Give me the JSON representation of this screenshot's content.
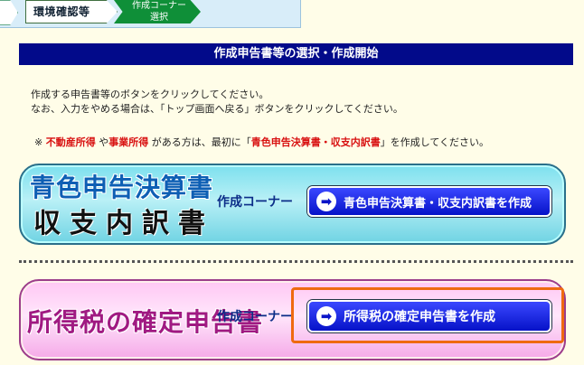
{
  "steps": {
    "confirm": "環境確認等",
    "current_l1": "作成コーナー",
    "current_l2": "選択"
  },
  "header": {
    "title": "作成申告書等の選択・作成開始"
  },
  "instructions": {
    "line1": "作成する申告書等のボタンをクリックしてください。",
    "line2": "なお、入力をやめる場合は、「トップ画面へ戻る」ボタンをクリックしてください。"
  },
  "note": {
    "prefix": "※ ",
    "real_estate": "不動産所得",
    "ya": " や",
    "business": "事業所得",
    "mid": " がある方は、最初に「",
    "docs": "青色申告決算書・収支内訳書",
    "suffix": "」を作成してください。"
  },
  "blue_corner": {
    "title_line1": "青色申告決算書",
    "title_line2": "収支内訳書",
    "corner_label": "作成コーナー",
    "button_label": "青色申告決算書・収支内訳書を作成"
  },
  "income_tax_corner": {
    "title": "所得税の確定申告書",
    "corner_label": "作成コーナー",
    "button_label": "所得税の確定申告書を作成"
  },
  "icons": {
    "arrow": "➡"
  },
  "colors": {
    "header_bg": "#020a8a",
    "accent_orange": "#ef6a10",
    "step_green": "#0f8f38"
  }
}
